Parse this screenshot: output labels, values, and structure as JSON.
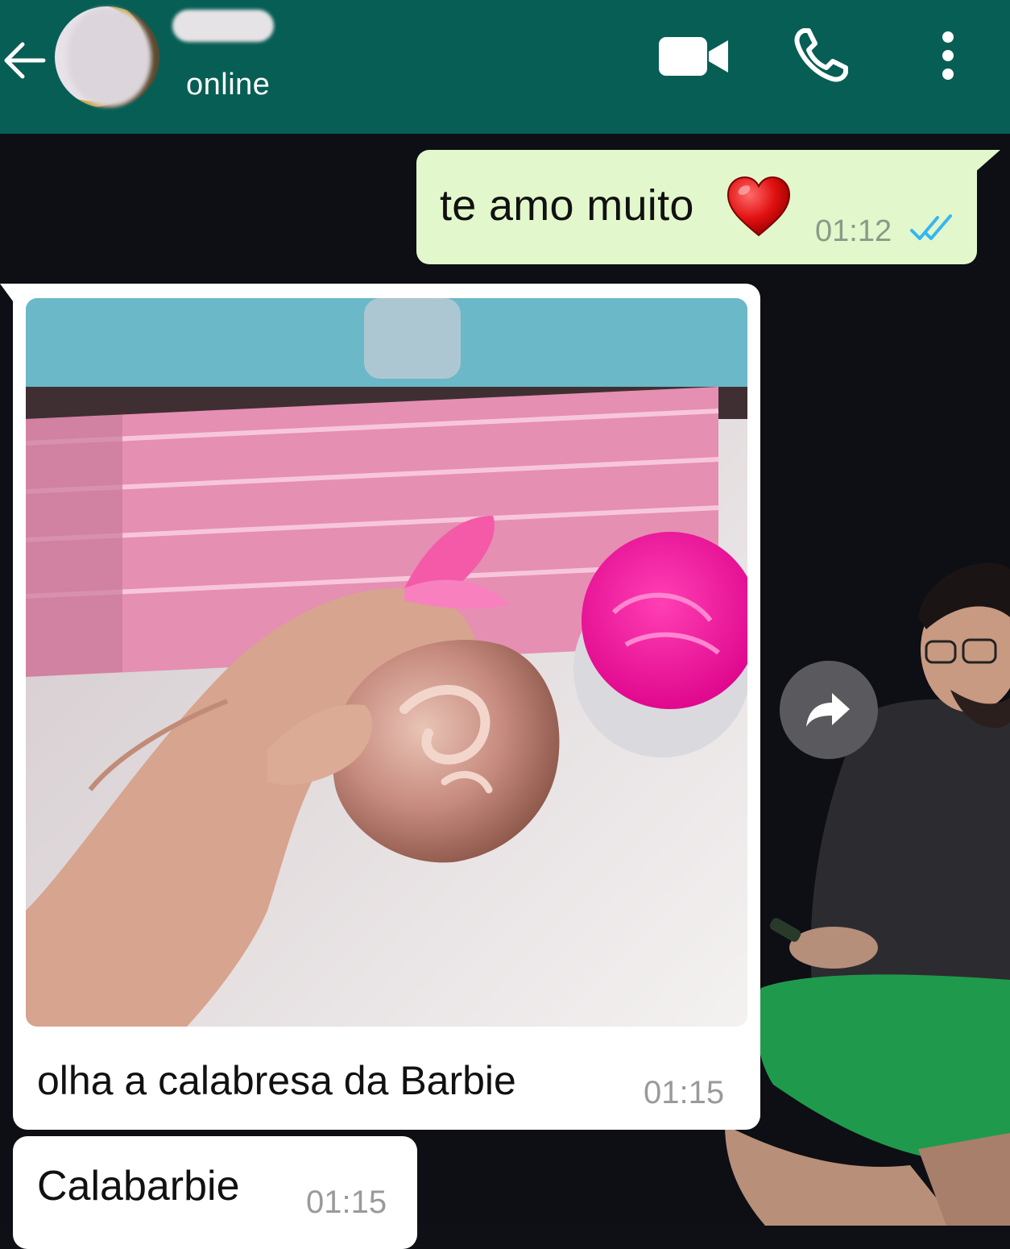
{
  "header": {
    "status": "online",
    "icons": {
      "back": "arrow-left-icon",
      "video": "video-camera-icon",
      "call": "phone-icon",
      "more": "more-vertical-icon"
    }
  },
  "messages": [
    {
      "direction": "outgoing",
      "text": "te amo muito",
      "emoji": "red-heart",
      "time": "01:12",
      "status": "read"
    },
    {
      "direction": "incoming",
      "type": "image",
      "caption": "olha a calabresa da Barbie",
      "time": "01:15"
    },
    {
      "direction": "incoming",
      "text": "Calabarbie",
      "time": "01:15"
    }
  ],
  "forward_button": {
    "icon": "forward-arrow-icon"
  },
  "colors": {
    "header": "#075e54",
    "outgoing_bubble": "#e2f7cb",
    "incoming_bubble": "#ffffff",
    "chat_background": "#0e0e15",
    "read_ticks": "#34b7f1"
  }
}
